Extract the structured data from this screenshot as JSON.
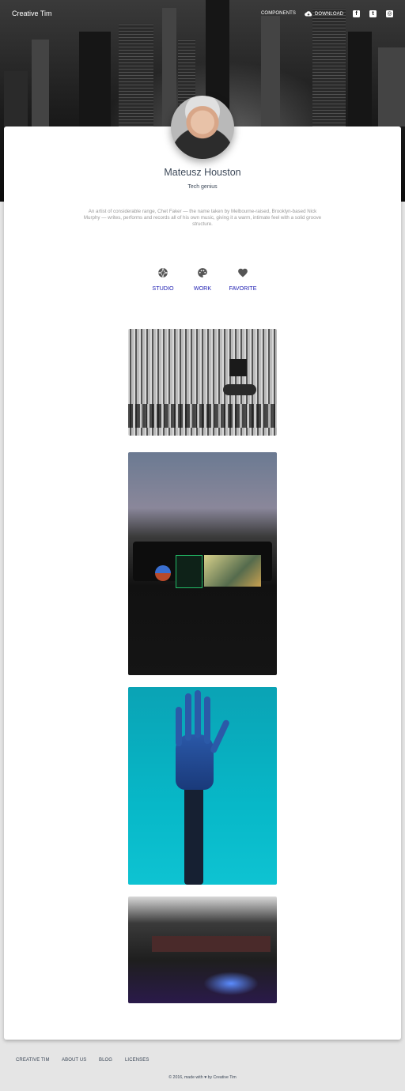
{
  "nav": {
    "brand": "Creative Tim",
    "components": "COMPONENTS",
    "download": "DOWNLOAD",
    "social": [
      "facebook-icon",
      "twitter-icon",
      "instagram-icon"
    ]
  },
  "profile": {
    "name": "Mateusz Houston",
    "title": "Tech genius",
    "description": "An artist of considerable range, Chet Faker — the name taken by Melbourne-raised, Brooklyn-based Nick Murphy — writes, performs and records all of his own music, giving it a warm, intimate feel with a solid groove structure."
  },
  "tabs": [
    {
      "label": "STUDIO",
      "icon": "camera-aperture-icon"
    },
    {
      "label": "WORK",
      "icon": "palette-icon"
    },
    {
      "label": "FAVORITE",
      "icon": "heart-icon"
    }
  ],
  "footer": {
    "links": [
      "CREATIVE TIM",
      "ABOUT US",
      "BLOG",
      "LICENSES"
    ],
    "copyright_prefix": "© 2016, made with",
    "copyright_suffix": "by Creative Tim"
  },
  "colors": {
    "accent": "#1a1ab0",
    "text": "#3c4858",
    "muted": "#999999"
  }
}
